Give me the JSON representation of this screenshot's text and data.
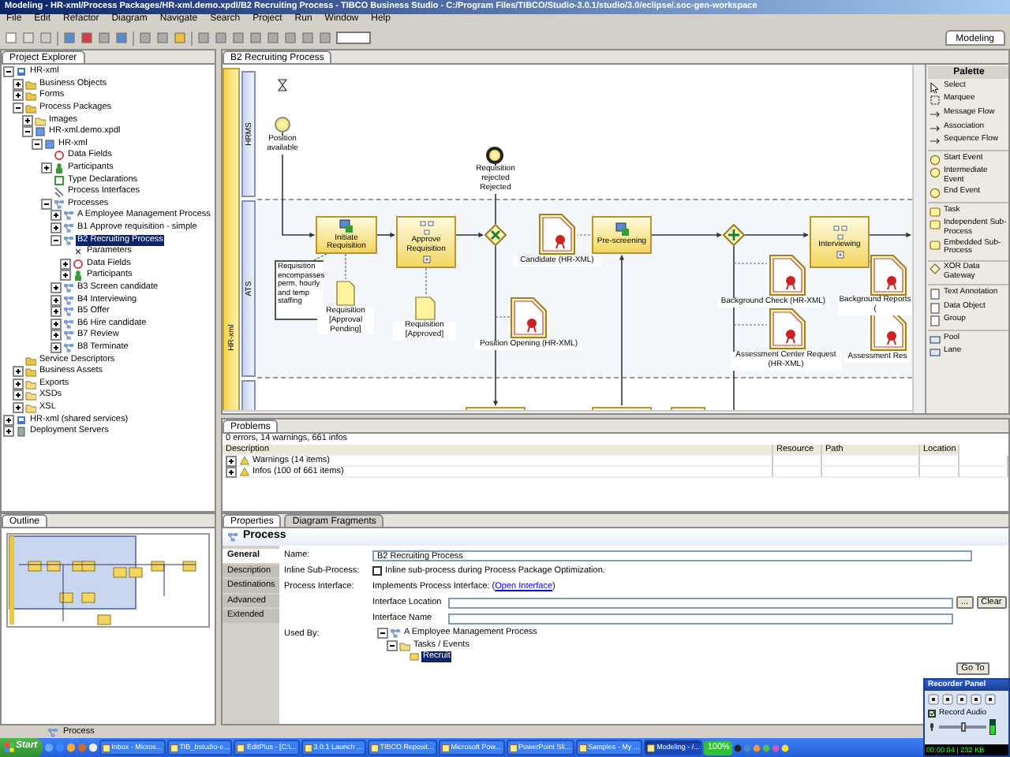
{
  "window": {
    "title": "Modeling - HR-xml/Process Packages/HR-xml.demo.xpdl/B2 Recruiting Process - TIBCO Business Studio - C:/Program Files/TIBCO/Studio-3.0.1/studio/3.0/eclipse/.soc-gen-workspace"
  },
  "perspective": {
    "label": "Modeling"
  },
  "menu": [
    "File",
    "Edit",
    "Refactor",
    "Diagram",
    "Navigate",
    "Search",
    "Project",
    "Run",
    "Window",
    "Help"
  ],
  "project_explorer": {
    "title": "Project Explorer",
    "tree": [
      {
        "label": "HR-xml",
        "kind": "project",
        "expanded": true,
        "selected": false,
        "children": [
          {
            "label": "Business Objects",
            "kind": "assets",
            "expanded": false,
            "selected": false
          },
          {
            "label": "Forms",
            "kind": "assets",
            "expanded": false,
            "selected": false
          },
          {
            "label": "Process Packages",
            "kind": "assets",
            "expanded": true,
            "selected": false,
            "children": [
              {
                "label": "Images",
                "kind": "folder",
                "expanded": false,
                "selected": false
              },
              {
                "label": "HR-xml.demo.xpdl",
                "kind": "package",
                "expanded": true,
                "selected": false,
                "children": [
                  {
                    "label": "HR-xml",
                    "kind": "package",
                    "expanded": true,
                    "selected": false,
                    "children": [
                      {
                        "label": "Data Fields",
                        "kind": "field",
                        "selected": false
                      },
                      {
                        "label": "Participants",
                        "kind": "participant",
                        "expanded": false,
                        "selected": false
                      },
                      {
                        "label": "Type Declarations",
                        "kind": "declaration",
                        "selected": false
                      },
                      {
                        "label": "Process Interfaces",
                        "kind": "interface",
                        "selected": false
                      },
                      {
                        "label": "Processes",
                        "kind": "process",
                        "expanded": true,
                        "selected": false,
                        "children": [
                          {
                            "label": "A Employee Management Process",
                            "kind": "process",
                            "expanded": false,
                            "selected": false
                          },
                          {
                            "label": "B1 Approve requisition - simple",
                            "kind": "process",
                            "expanded": false,
                            "selected": false
                          },
                          {
                            "label": "B2 Recruiting Process",
                            "kind": "process",
                            "expanded": true,
                            "selected": true,
                            "children": [
                              {
                                "label": "Parameters",
                                "kind": "parameter",
                                "selected": false
                              },
                              {
                                "label": "Data Fields",
                                "kind": "field",
                                "expanded": false,
                                "selected": false
                              },
                              {
                                "label": "Participants",
                                "kind": "participant",
                                "expanded": false,
                                "selected": false
                              }
                            ]
                          },
                          {
                            "label": "B3 Screen candidate",
                            "kind": "process",
                            "expanded": false,
                            "selected": false
                          },
                          {
                            "label": "B4 Interviewing",
                            "kind": "process",
                            "expanded": false,
                            "selected": false
                          },
                          {
                            "label": "B5 Offer",
                            "kind": "process",
                            "expanded": false,
                            "selected": false
                          },
                          {
                            "label": "B6 Hire candidate",
                            "kind": "process",
                            "expanded": false,
                            "selected": false
                          },
                          {
                            "label": "B7 Review",
                            "kind": "process",
                            "expanded": false,
                            "selected": false
                          },
                          {
                            "label": "B8 Terminate",
                            "kind": "process",
                            "expanded": false,
                            "selected": false
                          }
                        ]
                      }
                    ]
                  }
                ]
              }
            ]
          },
          {
            "label": "Service Descriptors",
            "kind": "assets",
            "selected": false
          },
          {
            "label": "Business Assets",
            "kind": "assets",
            "expanded": false,
            "selected": false
          },
          {
            "label": "Exports",
            "kind": "folder",
            "expanded": false,
            "selected": false
          },
          {
            "label": "XSDs",
            "kind": "folder",
            "expanded": false,
            "selected": false
          },
          {
            "label": "XSL",
            "kind": "folder",
            "expanded": false,
            "selected": false
          }
        ]
      },
      {
        "label": "HR-xml (shared services)",
        "kind": "project",
        "expanded": false,
        "selected": false
      },
      {
        "label": "Deployment Servers",
        "kind": "server",
        "expanded": false,
        "selected": false
      }
    ]
  },
  "editor": {
    "tab": "B2 Recruiting Process",
    "pool": "HR-xml",
    "lanes": [
      "HRMS",
      "ATS"
    ],
    "elements": [
      {
        "kind": "start-event",
        "label": "Position available"
      },
      {
        "kind": "end-event",
        "label": "Requisition rejected"
      },
      {
        "kind": "flow-label",
        "label": "Rejected"
      },
      {
        "kind": "task",
        "label": "Initiate Requisition"
      },
      {
        "kind": "subprocess",
        "label": "Approve Requisition"
      },
      {
        "kind": "xor-gateway"
      },
      {
        "kind": "document",
        "label": "Candidate (HR-XML)"
      },
      {
        "kind": "task",
        "label": "Pre-screening"
      },
      {
        "kind": "and-gateway"
      },
      {
        "kind": "subprocess",
        "label": "Interviewing"
      },
      {
        "kind": "annotation",
        "label": "Requisition encompasses perm, hourly and temp staffing"
      },
      {
        "kind": "data-object",
        "label": "Requisition [Approval Pending]"
      },
      {
        "kind": "data-object",
        "label": "Requisition [Approved]"
      },
      {
        "kind": "document",
        "label": "Position Opening (HR-XML)"
      },
      {
        "kind": "document",
        "label": "Background Check (HR-XML)"
      },
      {
        "kind": "document",
        "label": "Assessment Center Request (HR-XML)"
      },
      {
        "kind": "document",
        "label": "Background Reports ("
      },
      {
        "kind": "document",
        "label": "Assessment Res"
      },
      {
        "kind": "partial-task"
      },
      {
        "kind": "partial-task"
      },
      {
        "kind": "partial-task"
      }
    ]
  },
  "palette": {
    "title": "Palette",
    "items": [
      {
        "label": "Select",
        "kind": "select"
      },
      {
        "label": "Marquee",
        "kind": "marquee"
      },
      {
        "label": "Message Flow",
        "kind": "flow"
      },
      {
        "label": "Association",
        "kind": "flow"
      },
      {
        "label": "Sequence Flow",
        "kind": "flow"
      },
      {
        "label": "Start Event",
        "kind": "event"
      },
      {
        "label": "Intermediate Event",
        "kind": "event"
      },
      {
        "label": "End Event",
        "kind": "event"
      },
      {
        "label": "Task",
        "kind": "task"
      },
      {
        "label": "Independent Sub-Process",
        "kind": "task"
      },
      {
        "label": "Embedded Sub-Process",
        "kind": "task"
      },
      {
        "label": "XOR Data Gateway",
        "kind": "gateway"
      },
      {
        "label": "Text Annotation",
        "kind": "artifact"
      },
      {
        "label": "Data Object",
        "kind": "artifact"
      },
      {
        "label": "Group",
        "kind": "artifact"
      },
      {
        "label": "Pool",
        "kind": "container"
      },
      {
        "label": "Lane",
        "kind": "container"
      }
    ]
  },
  "problems": {
    "title": "Problems",
    "summary": "0 errors, 14 warnings, 661 infos",
    "columns": [
      "Description",
      "Resource",
      "Path",
      "Location"
    ],
    "rows": [
      {
        "label": "Warnings (14 items)",
        "expanded": false
      },
      {
        "label": "Infos (100 of 661 items)",
        "expanded": false
      }
    ]
  },
  "outline": {
    "title": "Outline"
  },
  "properties": {
    "tabs": [
      {
        "label": "Properties",
        "selected": true
      },
      {
        "label": "Diagram Fragments",
        "selected": false
      }
    ],
    "heading": "Process",
    "side_tabs": [
      {
        "label": "General",
        "selected": true
      },
      {
        "label": "Description",
        "selected": false
      },
      {
        "label": "Destinations",
        "selected": false
      },
      {
        "label": "Advanced",
        "selected": false
      },
      {
        "label": "Extended",
        "selected": false
      }
    ],
    "name_label": "Name:",
    "name_value": "B2 Recruiting Process",
    "inline_label": "Inline Sub-Process:",
    "inline_checkbox": {
      "label": "Inline sub-process during Process Package Optimization.",
      "checked": false
    },
    "interface_label": "Process Interface:",
    "interface_text": "Implements Process Interface: (",
    "interface_link": "Open Interface",
    "interface_end": ")",
    "location_label": "Interface Location",
    "browse_button": "...",
    "clear_button": "Clear",
    "iname_label": "Interface Name",
    "used_by_label": "Used By:",
    "used_by": [
      {
        "label": "A Employee Management Process",
        "kind": "process",
        "expanded": true,
        "selected": false,
        "children": [
          {
            "label": "Tasks / Events",
            "kind": "folder",
            "expanded": true,
            "selected": false,
            "children": [
              {
                "label": "Recruit",
                "kind": "task",
                "selected": true
              }
            ]
          }
        ]
      }
    ],
    "goto_button": "Go To"
  },
  "status_bar": {
    "text": "Process"
  },
  "taskbar": {
    "start": "Start",
    "buttons": [
      {
        "label": "Inbox - Micros...",
        "selected": false
      },
      {
        "label": "TIB_bstudio-e...",
        "selected": false
      },
      {
        "label": "EditPlus - [C:\\...",
        "selected": false
      },
      {
        "label": "3.0.1 Launch ...",
        "selected": false
      },
      {
        "label": "TIBCO Reposit...",
        "selected": false
      },
      {
        "label": "Microsoft Pow...",
        "selected": false
      },
      {
        "label": "PowerPoint Sli...",
        "selected": false
      },
      {
        "label": "Samples - My ...",
        "selected": false
      },
      {
        "label": "Modeling - /...",
        "selected": true
      }
    ],
    "zoom": "100%"
  },
  "recorder": {
    "title": "Recorder Panel",
    "record_audio": {
      "label": "Record Audio",
      "checked": true
    },
    "volume": {
      "level": 0.5
    },
    "readout": "00:00:04 | 232 KB"
  }
}
